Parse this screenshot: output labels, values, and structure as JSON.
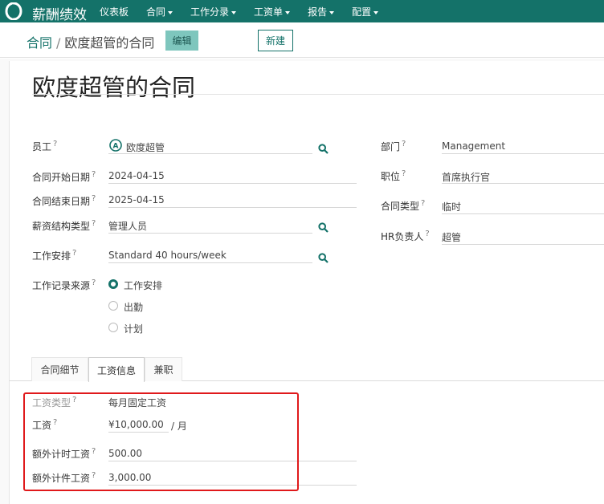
{
  "navbar": {
    "app_name": "薪酬绩效",
    "menu": [
      {
        "label": "仪表板",
        "dropdown": false
      },
      {
        "label": "合同",
        "dropdown": true
      },
      {
        "label": "工作分录",
        "dropdown": true
      },
      {
        "label": "工资单",
        "dropdown": true
      },
      {
        "label": "报告",
        "dropdown": true
      },
      {
        "label": "配置",
        "dropdown": true
      }
    ]
  },
  "breadcrumb": {
    "parent": "合同",
    "separator": "/",
    "current": "欧度超管的合同"
  },
  "buttons": {
    "edit": "编辑",
    "new": "新建"
  },
  "form": {
    "title": "欧度超管的合同",
    "left": {
      "employee": {
        "label": "员工",
        "value": "欧度超管",
        "avatar_letter": "A"
      },
      "start_date": {
        "label": "合同开始日期",
        "value": "2024-04-15"
      },
      "end_date": {
        "label": "合同结束日期",
        "value": "2025-04-15"
      },
      "structure_type": {
        "label": "薪资结构类型",
        "value": "管理人员"
      },
      "working_schedule": {
        "label": "工作安排",
        "value": "Standard 40 hours/week"
      },
      "work_entry_source": {
        "label": "工作记录来源",
        "options": [
          {
            "label": "工作安排",
            "checked": true
          },
          {
            "label": "出勤",
            "checked": false
          },
          {
            "label": "计划",
            "checked": false
          }
        ]
      }
    },
    "right": {
      "department": {
        "label": "部门",
        "value": "Management"
      },
      "job_position": {
        "label": "职位",
        "value": "首席执行官"
      },
      "contract_type": {
        "label": "合同类型",
        "value": "临时"
      },
      "hr_responsible": {
        "label": "HR负责人",
        "value": "超管"
      }
    },
    "required_mark": "?"
  },
  "tabs": [
    {
      "label": "合同细节",
      "active": false
    },
    {
      "label": "工资信息",
      "active": true
    },
    {
      "label": "兼职",
      "active": false
    }
  ],
  "salary": {
    "wage_type": {
      "label": "工资类型",
      "value": "每月固定工资"
    },
    "wage": {
      "label": "工资",
      "value": "¥10,000.00",
      "unit": "/ 月"
    },
    "hourly_extra": {
      "label": "额外计时工资",
      "value": "500.00"
    },
    "piece_extra": {
      "label": "额外计件工资",
      "value": "3,000.00"
    }
  },
  "colors": {
    "brand": "#147269",
    "edit_button": "#7ec6bd",
    "highlight_box": "#e0191b"
  }
}
